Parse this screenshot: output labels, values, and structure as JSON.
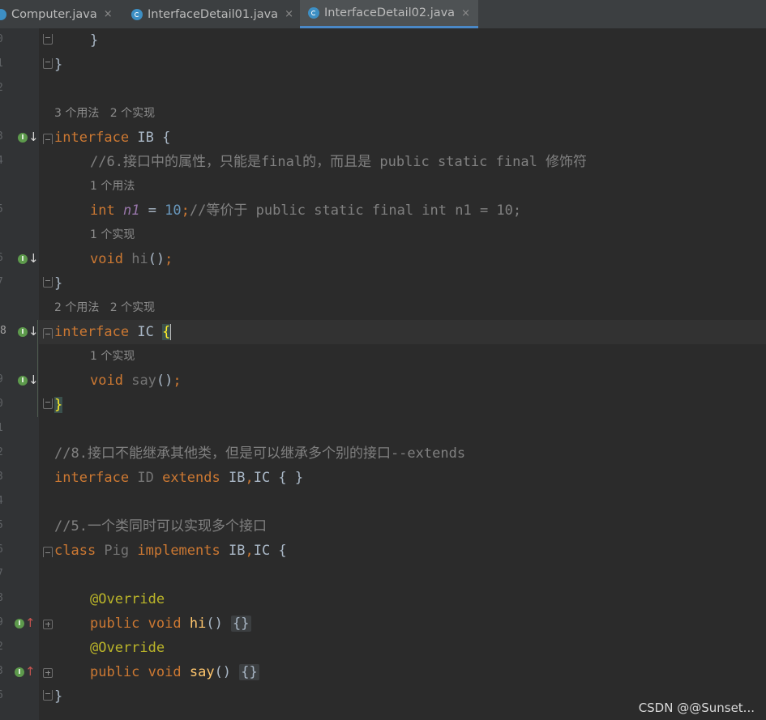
{
  "tabs": [
    {
      "label": "Computer.java",
      "active": false
    },
    {
      "label": "InterfaceDetail01.java",
      "active": false
    },
    {
      "label": "InterfaceDetail02.java",
      "active": true
    }
  ],
  "close_glyph": "×",
  "line_numbers": [
    "0",
    "1",
    "2",
    "3",
    "4",
    "5",
    "6",
    "7",
    "8",
    "9",
    "0",
    "1",
    "2",
    "3",
    "4",
    "5",
    "6",
    "7",
    "8",
    "9",
    "2",
    "3",
    "6"
  ],
  "hints": {
    "ib": "3 个用法   2 个实现",
    "n1": "1 个用法",
    "hi": "1 个实现",
    "ic": "2 个用法   2 个实现",
    "say": "1 个实现"
  },
  "code": {
    "l0_brace": "}",
    "l1_brace": "}",
    "ib_kw": "interface",
    "ib_name": " IB ",
    "ib_open": "{",
    "c6_comment": "//6.接口中的属性，只能是final的，而且是 public static final 修饰符",
    "n1_type": "int",
    "n1_name": "n1",
    "n1_eq": " = ",
    "n1_val": "10",
    "n1_semi": ";",
    "n1_comment": "//等价于 public static final int n1 = 10;",
    "hi_void": "void",
    "hi_name": "hi",
    "hi_parens": "()",
    "semi": ";",
    "ib_close": "}",
    "ic_kw": "interface",
    "ic_name": " IC ",
    "ic_open": "{",
    "say_void": "void",
    "say_name": "say",
    "say_parens": "()",
    "ic_close": "}",
    "c8_comment": "//8.接口不能继承其他类，但是可以继承多个别的接口--extends",
    "id_kw": "interface",
    "id_name": " ID ",
    "id_extends": "extends",
    "id_rest_1": " IB",
    "id_comma": ",",
    "id_rest_2": "IC { }",
    "c5_comment": "//5.一个类同时可以实现多个接口",
    "pig_kw": "class",
    "pig_name": " Pig ",
    "pig_impl": "implements",
    "pig_rest_1": " IB",
    "pig_comma": ",",
    "pig_rest_2": "IC {",
    "override": "@Override",
    "pub_void": "public void",
    "m_hi": "hi",
    "m_say": "say",
    "m_parens": "() ",
    "folded": "{}",
    "pig_close": "}"
  },
  "gutter_badge": "I",
  "arrow_down": "↓",
  "arrow_up": "↑",
  "watermark": "CSDN @@Sunset..."
}
